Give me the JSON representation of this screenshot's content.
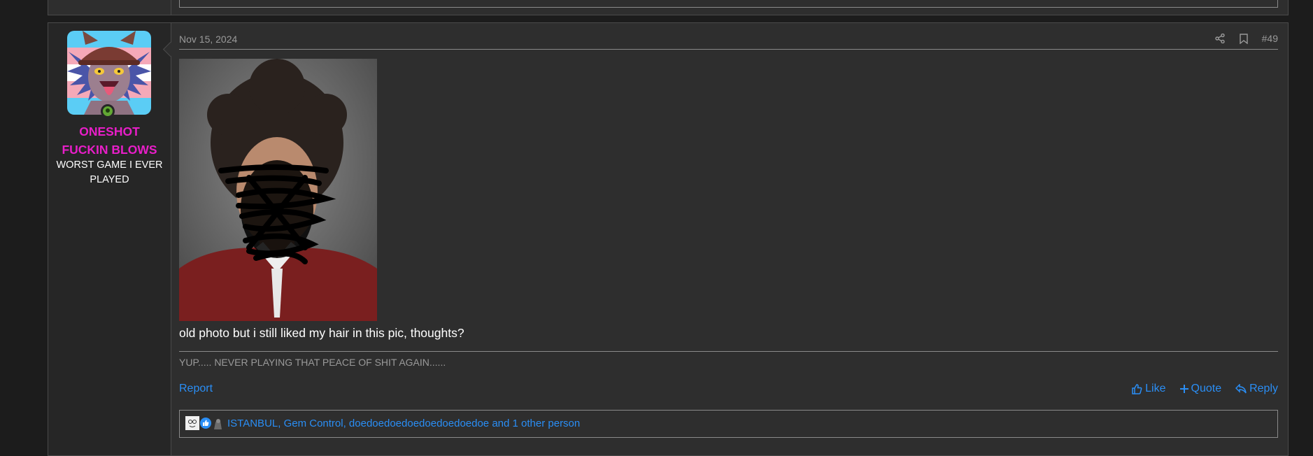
{
  "post": {
    "date": "Nov 15, 2024",
    "number": "#49",
    "body_text": "old photo but i still liked my hair in this pic, thoughts?",
    "signature": "YUP..... NEVER PLAYING THAT PEACE OF SHIT AGAIN......"
  },
  "user": {
    "name_line1": "ONESHOT",
    "name_line2": "FUCKIN BLOWS",
    "title_line1": "WORST GAME I EVER",
    "title_line2": "PLAYED",
    "name_color": "#e81ec8",
    "online": true
  },
  "actions": {
    "report": "Report",
    "like": "Like",
    "quote": "Quote",
    "reply": "Reply"
  },
  "reactions": {
    "text": "ISTANBUL, Gem Control, doedoedoedoedoedoedoedoe and 1 other person"
  },
  "icons": [
    "share-icon",
    "bookmark-icon",
    "thumbs-up-icon",
    "plus-icon",
    "reply-icon",
    "like-reaction-icon"
  ],
  "colors": {
    "link": "#2a8ef5",
    "background": "#1c1c1c",
    "panel": "#2e2e2e"
  }
}
